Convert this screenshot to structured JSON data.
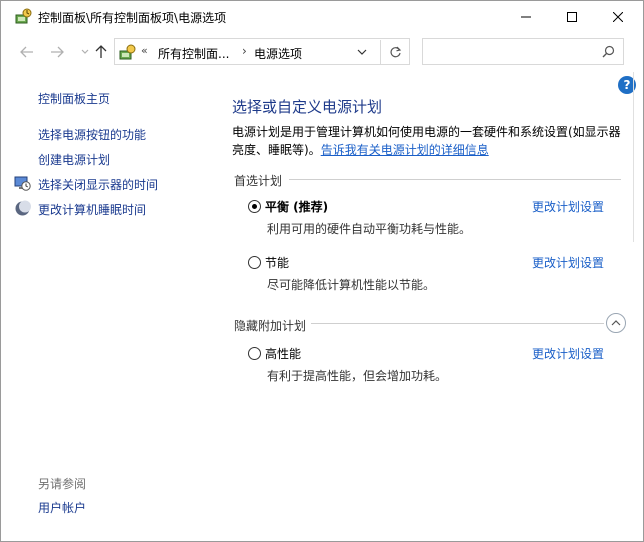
{
  "window": {
    "title": "控制面板\\所有控制面板项\\电源选项"
  },
  "address": {
    "chevron": "«",
    "segment1": "所有控制面...",
    "arrow": "›",
    "segment2": "电源选项"
  },
  "search": {
    "placeholder": ""
  },
  "help_label": "?",
  "left": {
    "home": "控制面板主页",
    "links": [
      {
        "label": "选择电源按钮的功能",
        "icon": ""
      },
      {
        "label": "创建电源计划",
        "icon": ""
      },
      {
        "label": "选择关闭显示器的时间",
        "icon": "monitor-clock-icon"
      },
      {
        "label": "更改计算机睡眠时间",
        "icon": "moon-icon"
      }
    ],
    "see_also": "另请参阅",
    "user_accounts": "用户帐户"
  },
  "main": {
    "title": "选择或自定义电源计划",
    "description": "电源计划是用于管理计算机如何使用电源的一套硬件和系统设置(如显示器亮度、睡眠等)。",
    "more_info_link": "告诉我有关电源计划的详细信息",
    "preferred_label": "首选计划",
    "hidden_label": "隐藏附加计划",
    "change_label": "更改计划设置",
    "plans": [
      {
        "name": "平衡 (推荐)",
        "desc": "利用可用的硬件自动平衡功耗与性能。",
        "selected": true
      },
      {
        "name": "节能",
        "desc": "尽可能降低计算机性能以节能。",
        "selected": false
      }
    ],
    "hidden_plans": [
      {
        "name": "高性能",
        "desc": "有利于提高性能，但会增加功耗。",
        "selected": false
      }
    ]
  },
  "colors": {
    "link": "#1a5fc8",
    "title": "#1e3a8a",
    "help": "#1f6fc5"
  }
}
